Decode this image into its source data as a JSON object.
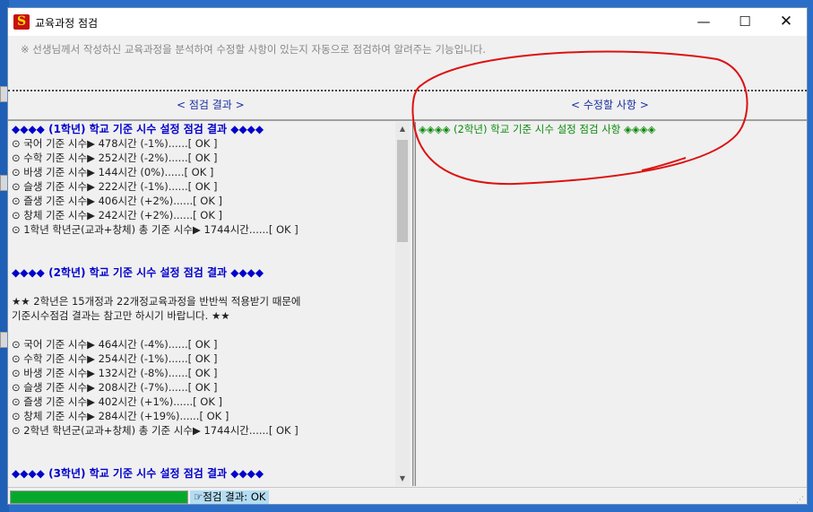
{
  "window": {
    "app_icon_letter": "S",
    "title": "교육과정 점검",
    "btn_minimize": "—",
    "btn_maximize": "☐",
    "btn_close": "✕"
  },
  "notice": "※ 선생님께서 작성하신 교육과정을 분석하여 수정할 사항이 있는지 자동으로 점검하여 알려주는 기능입니다.",
  "left_pane": {
    "heading": "< 점검 결과 >",
    "lines": [
      {
        "text": "◆◆◆◆  (1학년) 학교 기준 시수 설정 점검 결과  ◆◆◆◆",
        "kind": "head"
      },
      {
        "text": "⊙ 국어 기준 시수▶ 478시간 (-1%)......[ OK ]",
        "kind": "item"
      },
      {
        "text": "⊙ 수학 기준 시수▶ 252시간 (-2%)......[ OK ]",
        "kind": "item"
      },
      {
        "text": "⊙ 바생 기준 시수▶ 144시간 (0%)......[ OK ]",
        "kind": "item"
      },
      {
        "text": "⊙ 슬생 기준 시수▶ 222시간 (-1%)......[ OK ]",
        "kind": "item"
      },
      {
        "text": "⊙ 즐생 기준 시수▶ 406시간 (+2%)......[ OK ]",
        "kind": "item"
      },
      {
        "text": "⊙ 창체 기준 시수▶ 242시간 (+2%)......[ OK ]",
        "kind": "item"
      },
      {
        "text": "⊙ 1학년 학년군(교과+창체) 총 기준 시수▶ 1744시간......[ OK ]",
        "kind": "item"
      },
      {
        "text": "",
        "kind": "blank"
      },
      {
        "text": "",
        "kind": "blank"
      },
      {
        "text": "◆◆◆◆  (2학년) 학교 기준 시수 설정 점검 결과  ◆◆◆◆",
        "kind": "head"
      },
      {
        "text": "",
        "kind": "blank"
      },
      {
        "text": "★★  2학년은 15개정과 22개정교육과정을 반반씩 적용받기 때문에",
        "kind": "item"
      },
      {
        "text": "  기준시수점검 결과는 참고만 하시기 바랍니다.  ★★",
        "kind": "item"
      },
      {
        "text": "",
        "kind": "blank"
      },
      {
        "text": "⊙ 국어 기준 시수▶ 464시간 (-4%)......[ OK ]",
        "kind": "item"
      },
      {
        "text": "⊙ 수학 기준 시수▶ 254시간 (-1%)......[ OK ]",
        "kind": "item"
      },
      {
        "text": "⊙ 바생 기준 시수▶ 132시간 (-8%)......[ OK ]",
        "kind": "item"
      },
      {
        "text": "⊙ 슬생 기준 시수▶ 208시간 (-7%)......[ OK ]",
        "kind": "item"
      },
      {
        "text": "⊙ 즐생 기준 시수▶ 402시간 (+1%)......[ OK ]",
        "kind": "item"
      },
      {
        "text": "⊙ 창체 기준 시수▶ 284시간 (+19%)......[ OK ]",
        "kind": "item"
      },
      {
        "text": "⊙ 2학년 학년군(교과+창체) 총 기준 시수▶ 1744시간......[ OK ]",
        "kind": "item"
      },
      {
        "text": "",
        "kind": "blank"
      },
      {
        "text": "",
        "kind": "blank"
      },
      {
        "text": "◆◆◆◆  (3학년) 학교 기준 시수 설정 점검 결과  ◆◆◆◆",
        "kind": "head"
      }
    ]
  },
  "right_pane": {
    "heading": "< 수정할 사항 >",
    "lines": [
      {
        "text": "◈◈◈◈  (2학년) 학교 기준 시수 설정 점검 사항  ◈◈◈◈",
        "kind": "green"
      }
    ]
  },
  "statusbar": {
    "progress": 1.0,
    "status_text": "☞점검 결과: OK",
    "grip": "⋰"
  },
  "colors": {
    "heading_blue": "#1a2fa0",
    "result_head": "#0000cc",
    "fix_green": "#0a8a0a",
    "progress_green": "#06a82c",
    "annotation_red": "#dd1111"
  }
}
